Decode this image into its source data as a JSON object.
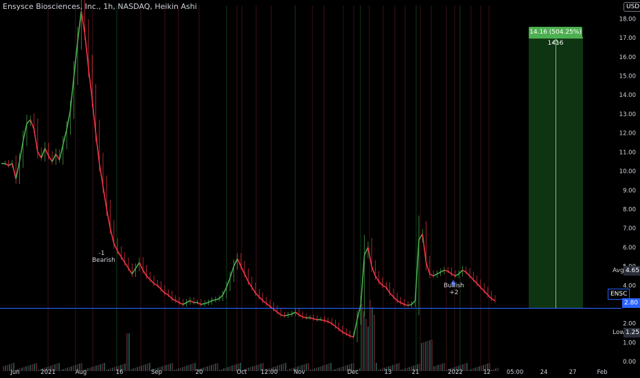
{
  "header": {
    "title": "Ensysce Biosciences, Inc., 1h, NASDAQ, Heikin Ashi",
    "currency": "USD"
  },
  "colors": {
    "background": "#000000",
    "up": "#4caf50",
    "down": "#f23645",
    "support_line": "#2962ff",
    "axis_text": "#d1d4dc",
    "target_box": "#1b5e20"
  },
  "price_labels": {
    "avg_label": "Avg",
    "avg_value": "4.65",
    "ticker_label": "ENSC",
    "support_value": "2.80",
    "low_label": "Low",
    "low_value": "1.25"
  },
  "annotations": {
    "bearish_count": "-1",
    "bearish_text": "Bearish",
    "bullish_text": "Bullish",
    "bullish_count": "+2",
    "target_text": "14.16 (504.25%) 1416"
  },
  "chart_data": {
    "type": "line",
    "style": "heikin-ashi candles",
    "ylim": [
      -0.5,
      18.7
    ],
    "y_ticks": [
      0.0,
      1.0,
      2.0,
      3.0,
      4.0,
      5.0,
      6.0,
      7.0,
      8.0,
      9.0,
      10.0,
      11.0,
      12.0,
      13.0,
      14.0,
      15.0,
      16.0,
      17.0,
      18.0
    ],
    "x_tick_labels": [
      "Jun",
      "2021",
      "Aug",
      "16",
      "Sep",
      "20",
      "Oct",
      "12:00",
      "Nov",
      "Dec",
      "13",
      "21",
      "2022",
      "12",
      "05:00",
      "24",
      "27",
      "Feb"
    ],
    "support_level": 2.8,
    "target_level": 17.0,
    "series": [
      {
        "values": [
          10.4,
          10.4,
          10.3,
          10.4,
          9.6,
          10.5,
          11.6,
          12.5,
          12.7,
          12.2,
          11.0,
          10.7,
          11.2,
          10.8,
          10.5,
          10.9,
          10.6,
          11.4,
          12.2,
          13.2,
          15.0,
          16.8,
          18.4,
          17.2,
          15.4,
          13.8,
          12.0,
          10.4,
          9.2,
          8.0,
          7.0,
          6.2,
          5.8,
          5.5,
          5.2,
          4.9,
          4.6,
          4.9,
          5.2,
          4.8,
          4.5,
          4.3,
          4.1,
          4.0,
          3.8,
          3.6,
          3.5,
          3.3,
          3.2,
          3.1,
          3.0,
          3.1,
          3.2,
          3.1,
          3.1,
          3.0,
          3.05,
          3.1,
          3.2,
          3.25,
          3.3,
          3.5,
          3.9,
          4.4,
          5.0,
          5.4,
          5.0,
          4.6,
          4.2,
          3.9,
          3.6,
          3.4,
          3.2,
          3.05,
          2.9,
          2.75,
          2.6,
          2.45,
          2.4,
          2.45,
          2.5,
          2.6,
          2.45,
          2.35,
          2.3,
          2.3,
          2.25,
          2.2,
          2.2,
          2.15,
          2.1,
          2.0,
          1.85,
          1.7,
          1.55,
          1.45,
          1.35,
          1.3,
          2.2,
          3.0,
          5.6,
          6.0,
          5.0,
          4.5,
          4.2,
          4.0,
          3.9,
          3.6,
          3.4,
          3.2,
          3.1,
          3.0,
          2.95,
          3.0,
          3.2,
          6.4,
          6.7,
          5.2,
          4.6,
          4.5,
          4.6,
          4.7,
          4.8,
          4.75,
          4.6,
          4.5,
          4.6,
          4.8,
          4.7,
          4.5,
          4.3,
          4.1,
          3.9,
          3.7,
          3.5,
          3.3,
          3.2
        ]
      }
    ]
  }
}
